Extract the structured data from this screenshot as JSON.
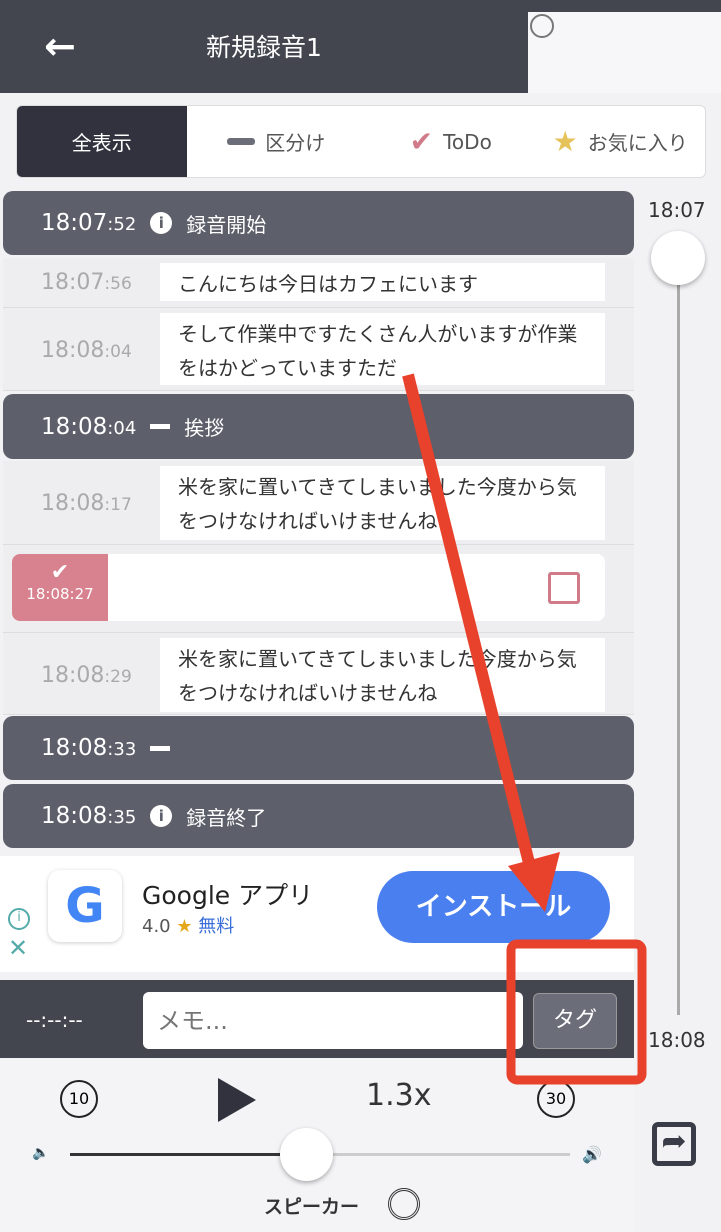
{
  "header": {
    "title": "新規録音1",
    "back_icon": "arrow-left-icon",
    "search_icon": "search-icon"
  },
  "filters": [
    {
      "label": "全表示",
      "active": true
    },
    {
      "label": "区分け",
      "icon": "dash-icon"
    },
    {
      "label": "ToDo",
      "icon": "check-icon"
    },
    {
      "label": "お気に入り",
      "icon": "star-icon"
    }
  ],
  "entries": {
    "s1": {
      "time": "18:07",
      "sec": ":52",
      "label": "録音開始",
      "icon": "info-icon"
    },
    "e1": {
      "time": "18:07",
      "sec": ":56",
      "text": "こんにちは今日はカフェにいます"
    },
    "e2": {
      "time": "18:08",
      "sec": ":04",
      "text": "そして作業中ですたくさん人がいますが作業をはかどっていますただ"
    },
    "s2": {
      "time": "18:08",
      "sec": ":04",
      "label": "挨拶",
      "icon": "dash-icon"
    },
    "e3": {
      "time": "18:08",
      "sec": ":17",
      "text": "米を家に置いてきてしまいました今度から気をつけなければいけませんね"
    },
    "todo": {
      "time": "18:08:27",
      "checked": false
    },
    "e4": {
      "time": "18:08",
      "sec": ":29",
      "text": "米を家に置いてきてしまいました今度から気をつけなければいけませんね"
    },
    "s3": {
      "time": "18:08",
      "sec": ":33",
      "label": "",
      "icon": "dash-icon"
    },
    "s4": {
      "time": "18:08",
      "sec": ":35",
      "label": "録音終了",
      "icon": "info-icon"
    }
  },
  "timeline": {
    "start": "18:07",
    "end": "18:08"
  },
  "ad": {
    "app": "Google アプリ",
    "rating": "4.0",
    "price": "無料",
    "install": "インストール"
  },
  "memo": {
    "time": "--:--:--",
    "placeholder": "メモ...",
    "tag": "タグ"
  },
  "player": {
    "rewind": "10",
    "forward": "30",
    "speed": "1.3x",
    "volume": 0.5,
    "output": "スピーカー"
  },
  "colors": {
    "dark": "#43454f",
    "section": "#5d5f6a",
    "todo": "#d8818f",
    "install": "#4a7ff0",
    "annotation": "#e8412c"
  }
}
